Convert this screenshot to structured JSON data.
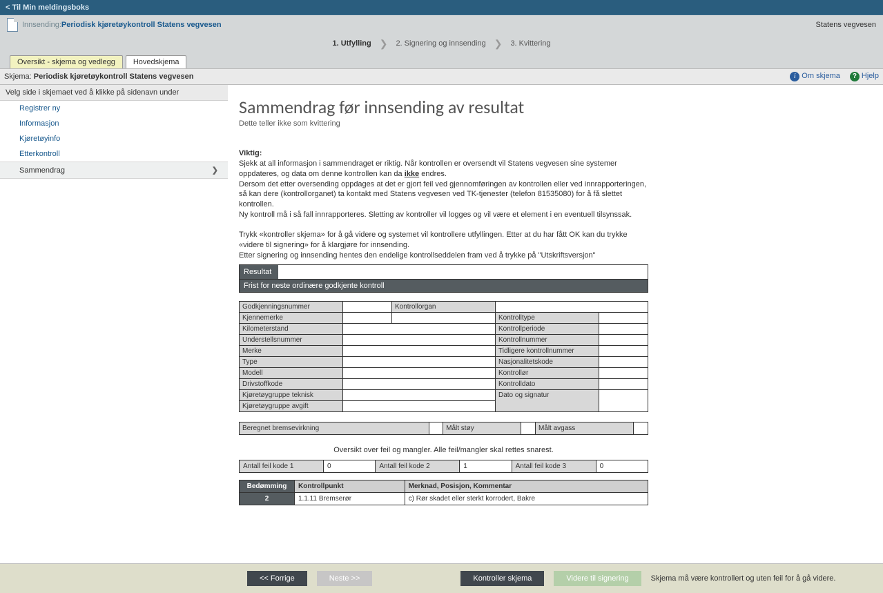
{
  "topbar": {
    "back": "< Til Min meldingsboks"
  },
  "header": {
    "sendLabel": "Innsending: ",
    "title": "Periodisk kjøretøykontroll Statens vegvesen",
    "brand": "Statens vegvesen"
  },
  "steps": {
    "s1": "1. Utfylling",
    "s2": "2. Signering og innsending",
    "s3": "3. Kvittering"
  },
  "tabs": {
    "active": "Oversikt - skjema og vedlegg",
    "other": "Hovedskjema"
  },
  "schemaBar": {
    "label": "Skjema: ",
    "name": "Periodisk kjøretøykontroll Statens vegvesen",
    "about": "Om skjema",
    "help": "Hjelp"
  },
  "sidebar": {
    "helper": "Velg side i skjemaet ved å klikke på sidenavn under",
    "items": [
      "Registrer ny",
      "Informasjon",
      "Kjøretøyinfo",
      "Etterkontroll",
      "Sammendrag"
    ]
  },
  "main": {
    "h1": "Sammendrag før innsending av resultat",
    "subtitle": "Dette teller ikke som kvittering",
    "importantLabel": "Viktig:",
    "p1a": "Sjekk at all informasjon i sammendraget er riktig. Når kontrollen er oversendt vil Statens vegvesen sine systemer oppdateres, og data om denne kontrollen kan da ",
    "p1ikke": "ikke",
    "p1b": " endres.",
    "p2": "Dersom det etter oversending oppdages at det er gjort feil ved gjennomføringen av kontrollen eller ved innrapporteringen, så kan dere (kontrollorganet) ta kontakt med Statens vegvesen ved TK-tjenester (telefon 81535080) for å få slettet kontrollen.",
    "p3": "Ny kontroll må i så fall innrapporteres. Sletting av kontroller vil logges og vil være et element i en eventuell tilsynssak.",
    "p4": "Trykk «kontroller skjema» for å gå videre og systemet vil kontrollere utfyllingen. Etter at du har fått OK kan du trykke «videre til signering» for å klargjøre for innsending.",
    "p5": "Etter signering og innsending hentes den endelige kontrollseddelen fram ved å trykke på \"Utskriftsversjon\""
  },
  "result": {
    "label": "Resultat",
    "value": "",
    "fristLabel": "Frist for neste ordinære godkjente kontroll",
    "fristValue": ""
  },
  "grid": {
    "godkjenningsnummer": "Godkjenningsnummer",
    "kontrollorgan": "Kontrollorgan",
    "kjennemerke": "Kjennemerke",
    "kontrolltype": "Kontrolltype",
    "kilometerstand": "Kilometerstand",
    "kontrollperiode": "Kontrollperiode",
    "understellsnummer": "Understellsnummer",
    "kontrollnummer": "Kontrollnummer",
    "merke": "Merke",
    "tidligereKontrollnummer": "Tidligere kontrollnummer",
    "type": "Type",
    "nasjonalitetskode": "Nasjonalitetskode",
    "modell": "Modell",
    "kontrollor": "Kontrollør",
    "drivstoffkode": "Drivstoffkode",
    "kontrolldato": "Kontrolldato",
    "kjoregruppeTeknisk": "Kjøretøygruppe teknisk",
    "datoSignatur": "Dato og signatur",
    "kjoregruppeAvgift": "Kjøretøygruppe avgift"
  },
  "measure": {
    "brems": "Beregnet bremsevirkning",
    "stoy": "Målt støy",
    "avgass": "Målt avgass"
  },
  "overview": "Oversikt over feil og mangler. Alle feil/mangler skal rettes snarest.",
  "counts": {
    "k1": "Antall feil kode 1",
    "v1": "0",
    "k2": "Antall feil kode 2",
    "v2": "1",
    "k3": "Antall feil kode 3",
    "v3": "0"
  },
  "defectsHeader": {
    "bedomming": "Bedømming",
    "kontrollpunkt": "Kontrollpunkt",
    "merknad": "Merknad, Posisjon, Kommentar"
  },
  "defects": [
    {
      "bed": "2",
      "kp": "1.1.11 Bremserør",
      "merk": "c) Rør skadet eller sterkt korrodert, Bakre"
    }
  ],
  "footer": {
    "prev": "<< Forrige",
    "next": "Neste >>",
    "check": "Kontroller skjema",
    "sign": "Videre til signering",
    "note": "Skjema må være kontrollert og uten feil for å gå videre."
  }
}
